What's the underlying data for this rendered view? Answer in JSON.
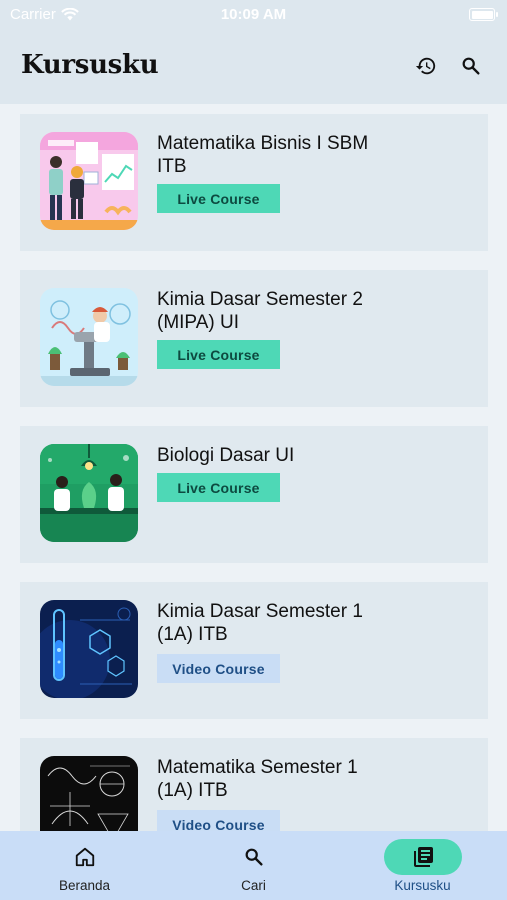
{
  "status_bar": {
    "carrier": "Carrier",
    "time": "10:09 AM"
  },
  "header": {
    "title": "Kursusku",
    "history_icon": "history-icon",
    "search_icon": "search-icon"
  },
  "courses": [
    {
      "title": "Matematika Bisnis I SBM ITB",
      "type": "Live Course"
    },
    {
      "title": "Kimia Dasar Semester 2 (MIPA) UI",
      "type": "Live Course"
    },
    {
      "title": "Biologi Dasar UI",
      "type": "Live Course"
    },
    {
      "title": "Kimia Dasar Semester 1 (1A) ITB",
      "type": "Video Course"
    },
    {
      "title": "Matematika Semester 1 (1A) ITB",
      "type": "Video Course"
    }
  ],
  "bottom_nav": [
    {
      "label": "Beranda",
      "icon": "home-icon",
      "active": false
    },
    {
      "label": "Cari",
      "icon": "search-icon",
      "active": false
    },
    {
      "label": "Kursusku",
      "icon": "library-icon",
      "active": true
    }
  ],
  "colors": {
    "header_bg": "#dde7ee",
    "page_bg": "#edf2f6",
    "card_bg": "#e0e9ef",
    "live_badge": "#4ed8b6",
    "video_badge": "#c9ddf5",
    "nav_bg": "#c9ddf7"
  }
}
